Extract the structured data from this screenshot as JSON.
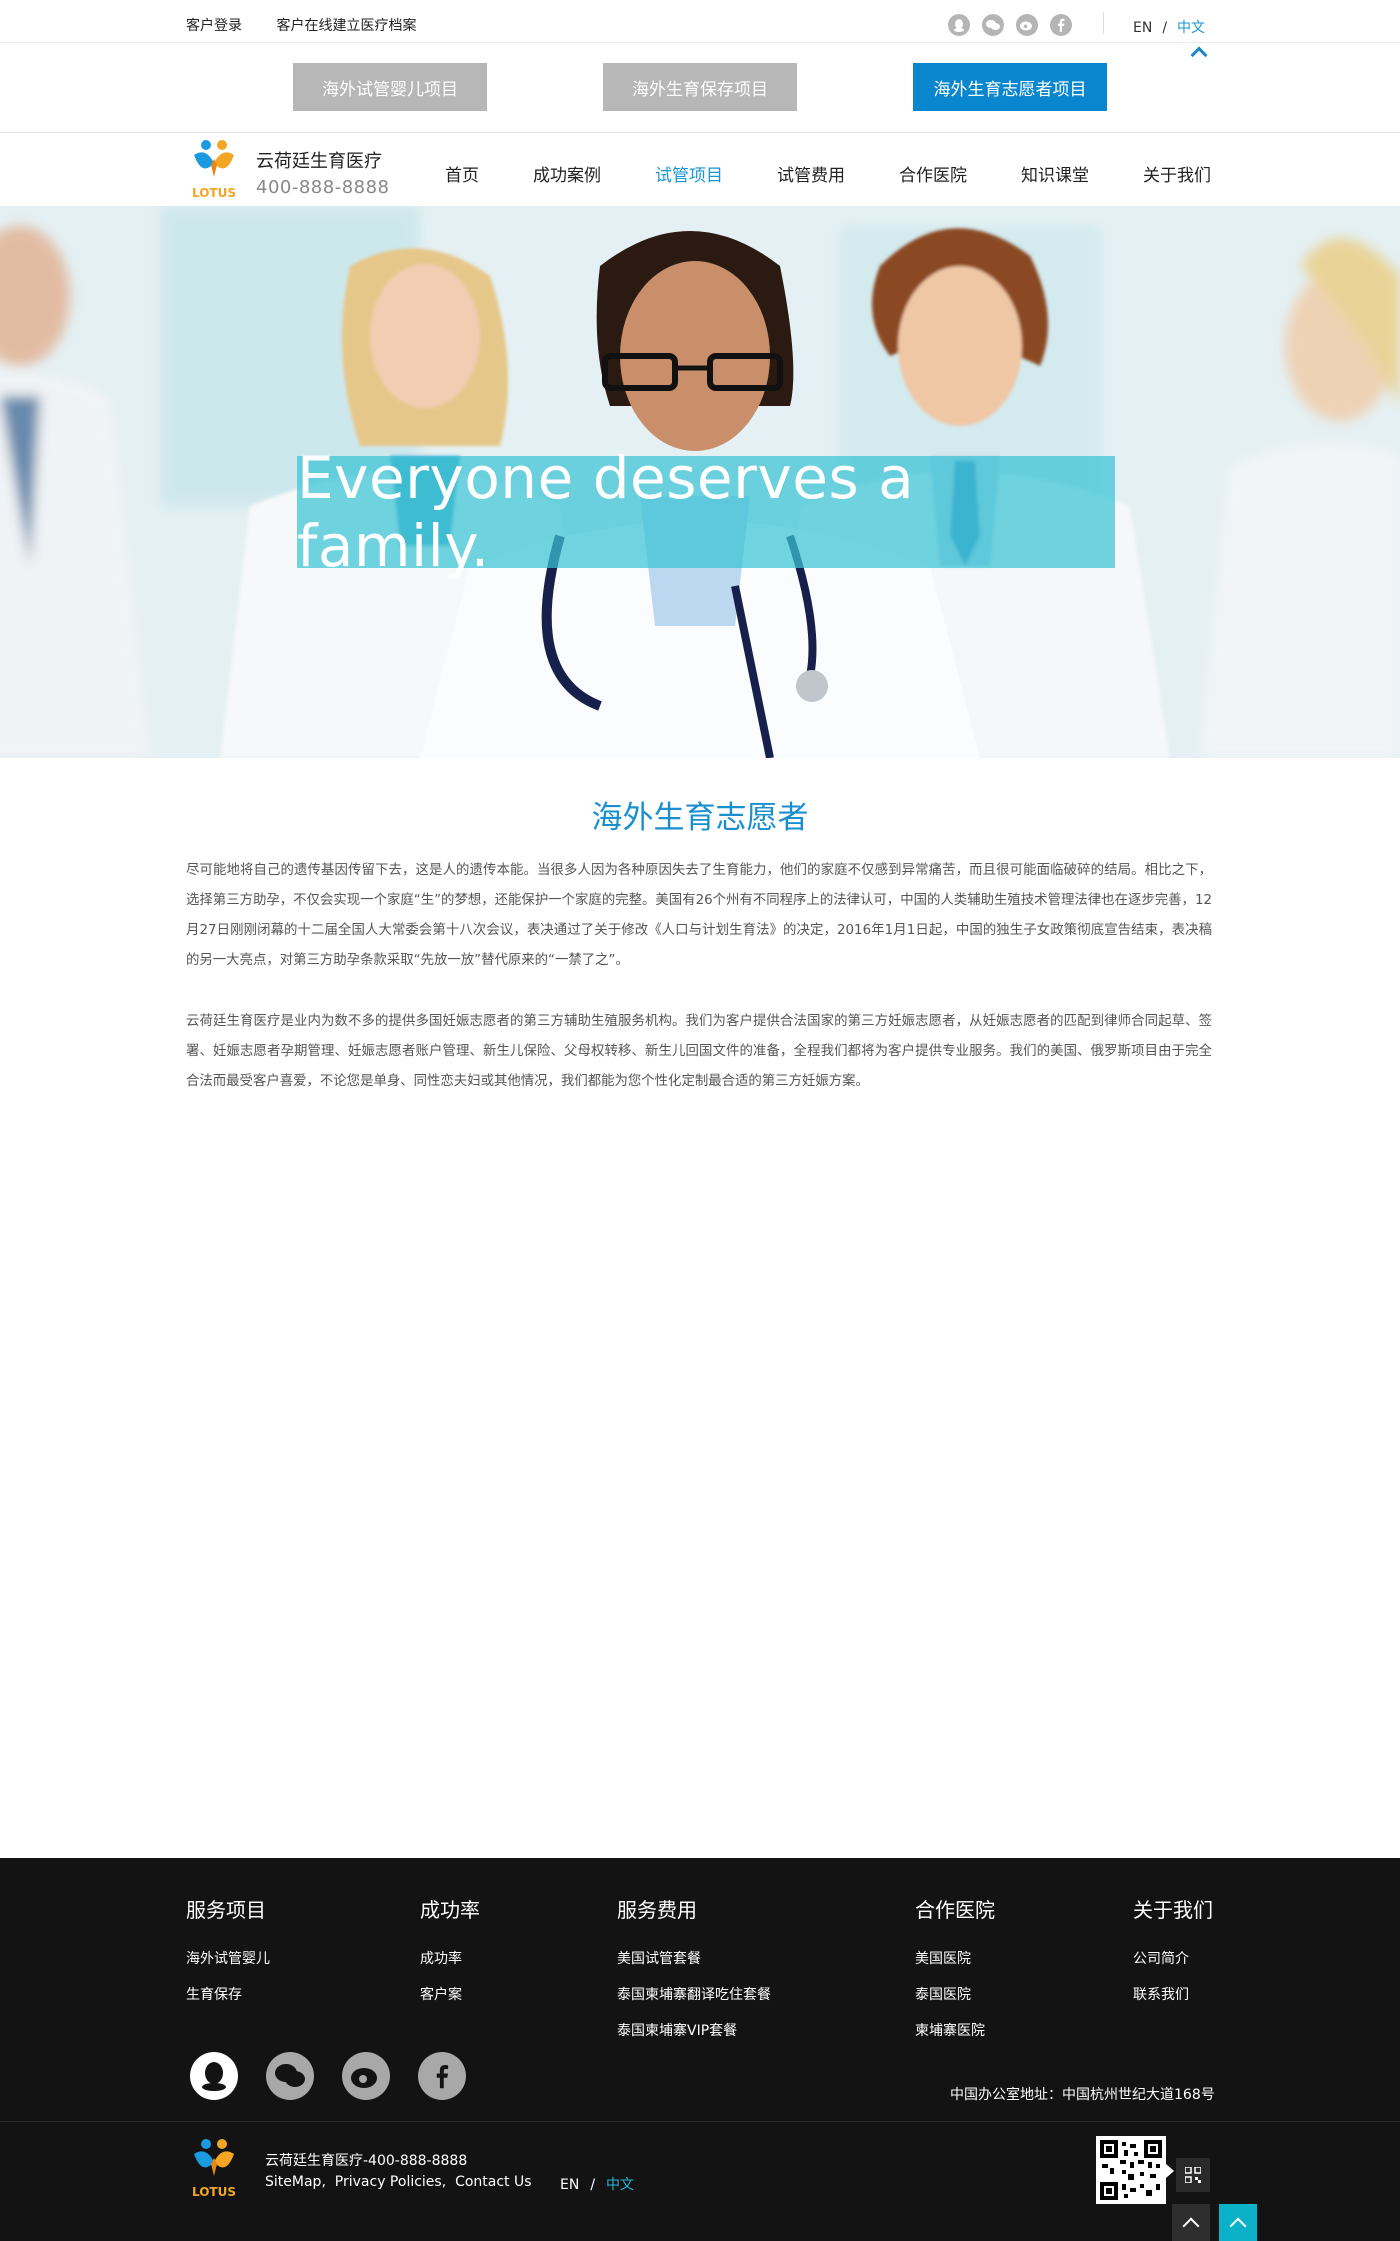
{
  "topbar": {
    "login": "客户登录",
    "archive": "客户在线建立医疗档案",
    "social_icons": [
      "qq-icon",
      "wechat-icon",
      "weibo-icon",
      "facebook-icon"
    ],
    "lang_en": "EN",
    "lang_sep": "/",
    "lang_zh": "中文"
  },
  "project_tabs": [
    {
      "label": "海外试管婴儿项目",
      "active": false
    },
    {
      "label": "海外生育保存项目",
      "active": false
    },
    {
      "label": "海外生育志愿者项目",
      "active": true
    }
  ],
  "header": {
    "logo_text": "LOTUS",
    "brand_name": "云荷廷生育医疗",
    "phone": "400-888-8888"
  },
  "nav": {
    "items": [
      "首页",
      "成功案例",
      "试管项目",
      "试管费用",
      "合作医院",
      "知识课堂",
      "关于我们"
    ],
    "active": "试管项目"
  },
  "hero": {
    "headline": "Everyone deserves a family."
  },
  "content": {
    "title": "海外生育志愿者",
    "paragraph1": "尽可能地将自己的遗传基因传留下去，这是人的遗传本能。当很多人因为各种原因失去了生育能力，他们的家庭不仅感到异常痛苦，而且很可能面临破碎的结局。相比之下，选择第三方助孕，不仅会实现一个家庭“生”的梦想，还能保护一个家庭的完整。美国有26个州有不同程序上的法律认可，中国的人类辅助生殖技术管理法律也在逐步完善，12月27日刚刚闭幕的十二届全国人大常委会第十八次会议，表决通过了关于修改《人口与计划生育法》的决定，2016年1月1日起，中国的独生子女政策彻底宣告结束，表决稿的另一大亮点，对第三方助孕条款采取“先放一放”替代原来的“一禁了之”。",
    "paragraph2": "云荷廷生育医疗是业内为数不多的提供多国妊娠志愿者的第三方辅助生殖服务机构。我们为客户提供合法国家的第三方妊娠志愿者，从妊娠志愿者的匹配到律师合同起草、签署、妊娠志愿者孕期管理、妊娠志愿者账户管理、新生儿保险、父母权转移、新生儿回国文件的准备，全程我们都将为客户提供专业服务。我们的美国、俄罗斯项目由于完全合法而最受客户喜爱，不论您是单身、同性恋夫妇或其他情况，我们都能为您个性化定制最合适的第三方妊娠方案。"
  },
  "footer": {
    "columns": [
      {
        "heading": "服务项目",
        "items": [
          "海外试管婴儿",
          "生育保存"
        ]
      },
      {
        "heading": "成功率",
        "items": [
          "成功率",
          "客户案"
        ]
      },
      {
        "heading": "服务费用",
        "items": [
          "美国试管套餐",
          "泰国柬埔寨翻译吃住套餐",
          "泰国柬埔寨VIP套餐"
        ]
      },
      {
        "heading": "合作医院",
        "items": [
          "美国医院",
          "泰国医院",
          "柬埔寨医院"
        ]
      },
      {
        "heading": "关于我们",
        "items": [
          "公司简介",
          "联系我们"
        ]
      }
    ],
    "social_icons": [
      "qq-icon",
      "wechat-icon",
      "weibo-icon",
      "facebook-icon"
    ],
    "address": "中国办公室地址：中国杭州世纪大道168号",
    "brand_line": "云荷廷生育医疗-400-888-8888",
    "links": [
      "SiteMap",
      "Privacy Policies",
      "Contact Us"
    ],
    "link_sep": ",",
    "lang_en": "EN",
    "lang_sep": "/",
    "lang_zh": "中文"
  },
  "colors": {
    "accent": "#1a96d4",
    "active_tab": "#0a86cf",
    "inactive_tab": "#b7b7b7",
    "hero_banner": "#3ac4d4",
    "footer_bg": "#131313",
    "back_to_top": "#0bb2c7"
  }
}
